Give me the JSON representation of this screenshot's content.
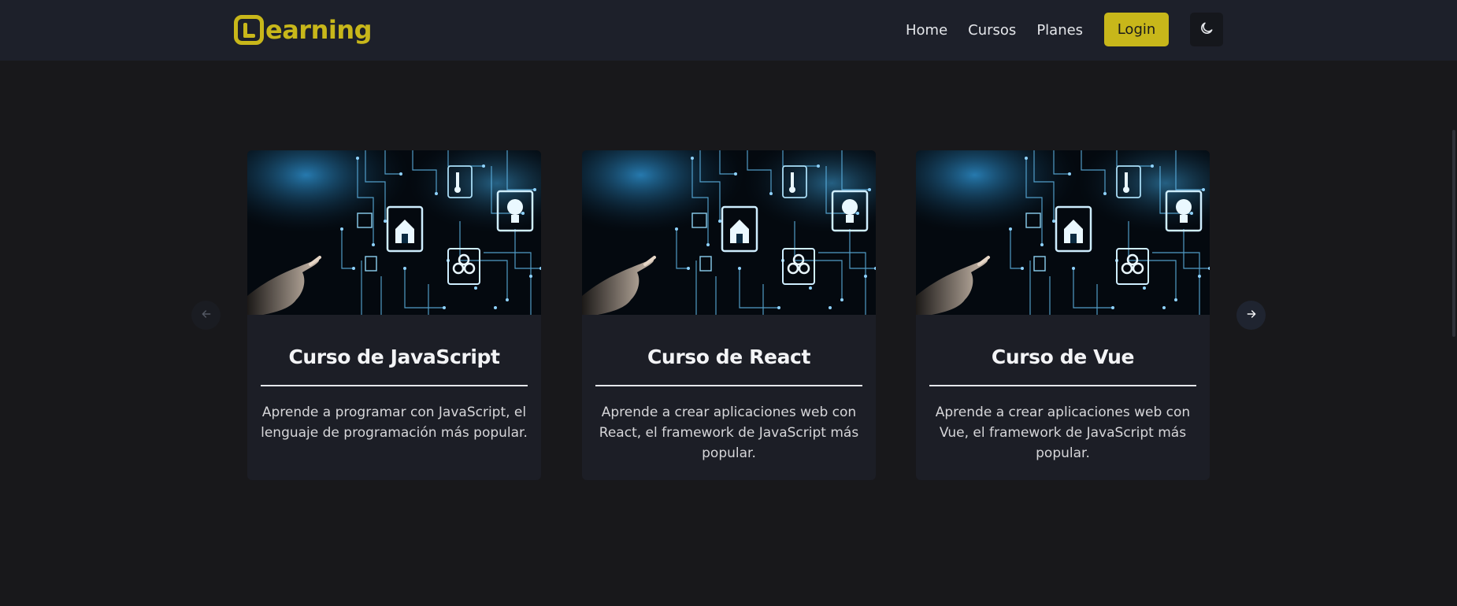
{
  "brand": {
    "name": "earning",
    "logo_letter": "L",
    "accent_color": "#c8b71a"
  },
  "nav": {
    "links": [
      {
        "label": "Home"
      },
      {
        "label": "Cursos"
      },
      {
        "label": "Planes"
      }
    ],
    "login_label": "Login",
    "theme_toggle_icon": "moon-icon"
  },
  "carousel": {
    "prev_icon": "arrow-left-icon",
    "next_icon": "arrow-right-icon",
    "cards": [
      {
        "title": "Curso de JavaScript",
        "description": "Aprende a programar con JavaScript, el lenguaje de programación más popular.",
        "image": "circuit-board-hand-image"
      },
      {
        "title": "Curso de React",
        "description": "Aprende a crear aplicaciones web con React, el framework de JavaScript más popular.",
        "image": "circuit-board-hand-image"
      },
      {
        "title": "Curso de Vue",
        "description": "Aprende a crear aplicaciones web con Vue, el framework de JavaScript más popular.",
        "image": "circuit-board-hand-image"
      }
    ]
  },
  "colors": {
    "background": "#18181b",
    "navbar": "#1d202a",
    "card": "#1c1e26"
  }
}
